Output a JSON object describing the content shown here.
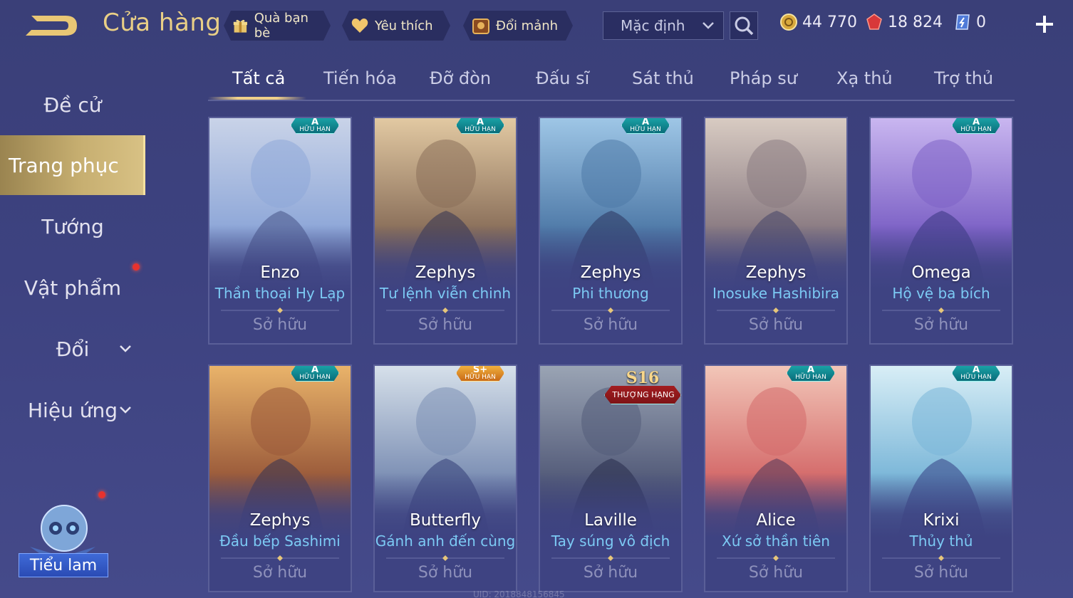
{
  "header": {
    "title": "Cửa hàng",
    "chips": [
      {
        "label": "Quà bạn bè",
        "icon": "gift-icon"
      },
      {
        "label": "Yêu thích",
        "icon": "heart-icon"
      },
      {
        "label": "Đổi mảnh",
        "icon": "chest-icon"
      }
    ],
    "sort": {
      "value": "Mặc định"
    },
    "currencies": [
      {
        "icon": "gold-coin-icon",
        "value": "44 770"
      },
      {
        "icon": "ruby-gem-icon",
        "value": "18 824"
      },
      {
        "icon": "voucher-icon",
        "value": "0"
      }
    ]
  },
  "sidebar": {
    "items": [
      {
        "label": "Đề cử"
      },
      {
        "label": "Trang phục"
      },
      {
        "label": "Tướng"
      },
      {
        "label": "Vật phẩm"
      },
      {
        "label": "Đổi"
      },
      {
        "label": "Hiệu ứng"
      }
    ],
    "mascot_label": "Tiểu lam"
  },
  "tabs": [
    "Tất cả",
    "Tiến hóa",
    "Đỡ đòn",
    "Đấu sĩ",
    "Sát thủ",
    "Pháp sư",
    "Xạ thủ",
    "Trợ thủ"
  ],
  "cards": [
    {
      "hero": "Enzo",
      "skin": "Thần thoại Hy Lạp",
      "status": "Sở hữu",
      "badge_tier": "A",
      "badge_label": "HỮU HẠN",
      "palette": [
        "#c9d3e8",
        "#8ea7d8",
        "#4d5a8e"
      ]
    },
    {
      "hero": "Zephys",
      "skin": "Tư lệnh viễn chinh",
      "status": "Sở hữu",
      "badge_tier": "A",
      "badge_label": "HỮU HẠN",
      "palette": [
        "#e2c9a2",
        "#8a6f5a",
        "#3b3854"
      ]
    },
    {
      "hero": "Zephys",
      "skin": "Phi thương",
      "status": "Sở hữu",
      "badge_tier": "A",
      "badge_label": "HỮU HẠN",
      "palette": [
        "#9ec6e6",
        "#4f7aa8",
        "#2e3b64"
      ]
    },
    {
      "hero": "Zephys",
      "skin": "Inosuke Hashibira",
      "status": "Sở hữu",
      "badge_tier": "",
      "badge_label": "",
      "palette": [
        "#d8cbc2",
        "#8a7b82",
        "#4b4a6a"
      ]
    },
    {
      "hero": "Omega",
      "skin": "Hộ vệ ba bích",
      "status": "Sở hữu",
      "badge_tier": "A",
      "badge_label": "HỮU HẠN",
      "palette": [
        "#c9b6f0",
        "#7d62c6",
        "#3e3a86"
      ]
    },
    {
      "hero": "Zephys",
      "skin": "Đầu bếp Sashimi",
      "status": "Sở hữu",
      "badge_tier": "A",
      "badge_label": "HỮU HẠN",
      "palette": [
        "#e9b36a",
        "#9a5a3a",
        "#3c3550"
      ]
    },
    {
      "hero": "Butterfly",
      "skin": "Gánh anh đến cùng",
      "status": "Sở hữu",
      "badge_tier": "S+",
      "badge_label": "HỮU HẠN",
      "palette": [
        "#d6e0ea",
        "#7c8fb4",
        "#39447c"
      ]
    },
    {
      "hero": "Laville",
      "skin": "Tay súng vô địch",
      "status": "Sở hữu",
      "badge_tier": "S16",
      "badge_label": "THƯỢNG HẠNG",
      "palette": [
        "#9aa4b4",
        "#545c7a",
        "#2c3050"
      ]
    },
    {
      "hero": "Alice",
      "skin": "Xứ sở thần tiên",
      "status": "Sở hữu",
      "badge_tier": "A",
      "badge_label": "HỮU HẠN",
      "palette": [
        "#f2c6b8",
        "#d46a6a",
        "#5a3a5a"
      ]
    },
    {
      "hero": "Krixi",
      "skin": "Thủy thủ",
      "status": "Sở hữu",
      "badge_tier": "A",
      "badge_label": "HỮU HẠN",
      "palette": [
        "#d8eef6",
        "#7ab6d8",
        "#3a4a8a"
      ]
    }
  ],
  "colors": {
    "accent_gold": "#e9cf86",
    "skin_name_blue": "#7ccaf4",
    "owned_gray": "#8e91bb",
    "notification_red": "#e8322e"
  }
}
